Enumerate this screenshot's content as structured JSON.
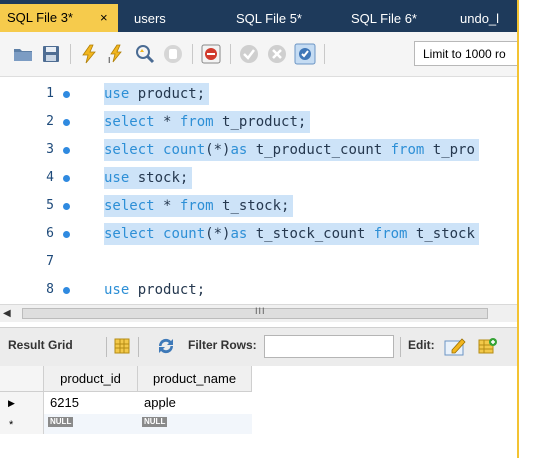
{
  "tabs": [
    {
      "label": "SQL File 3*",
      "active": true,
      "close": "×"
    },
    {
      "label": "users"
    },
    {
      "label": "SQL File 5*"
    },
    {
      "label": "SQL File 6*"
    },
    {
      "label": "undo_l"
    }
  ],
  "toolbar": {
    "limit_label": "Limit to 1000 ro",
    "icons": [
      "open-folder-icon",
      "save-icon",
      "execute-icon",
      "execute-current-icon",
      "explain-icon",
      "stop-icon",
      "toggle-error-icon",
      "commit-icon",
      "rollback-icon",
      "autocommit-icon"
    ]
  },
  "editor": {
    "lines": [
      {
        "num": "1",
        "dot": true,
        "highlight": true,
        "tokens": [
          [
            "kw",
            "use"
          ],
          [
            "id",
            " product;"
          ]
        ]
      },
      {
        "num": "2",
        "dot": true,
        "highlight": true,
        "tokens": [
          [
            "kw",
            "select"
          ],
          [
            "id",
            " * "
          ],
          [
            "kw",
            "from"
          ],
          [
            "id",
            " t_product;"
          ]
        ]
      },
      {
        "num": "3",
        "dot": true,
        "highlight": true,
        "tokens": [
          [
            "kw",
            "select"
          ],
          [
            "id",
            " "
          ],
          [
            "kw",
            "count"
          ],
          [
            "id",
            "(*)"
          ],
          [
            "kw",
            "as"
          ],
          [
            "id",
            " t_product_count "
          ],
          [
            "kw",
            "from"
          ],
          [
            "id",
            " t_pro"
          ]
        ]
      },
      {
        "num": "4",
        "dot": true,
        "highlight": true,
        "tokens": [
          [
            "kw",
            "use"
          ],
          [
            "id",
            " stock;"
          ]
        ]
      },
      {
        "num": "5",
        "dot": true,
        "highlight": true,
        "tokens": [
          [
            "kw",
            "select"
          ],
          [
            "id",
            " * "
          ],
          [
            "kw",
            "from"
          ],
          [
            "id",
            " t_stock;"
          ]
        ]
      },
      {
        "num": "6",
        "dot": true,
        "highlight": true,
        "tokens": [
          [
            "kw",
            "select"
          ],
          [
            "id",
            " "
          ],
          [
            "kw",
            "count"
          ],
          [
            "id",
            "(*)"
          ],
          [
            "kw",
            "as"
          ],
          [
            "id",
            " t_stock_count "
          ],
          [
            "kw",
            "from"
          ],
          [
            "id",
            " t_stock"
          ]
        ]
      },
      {
        "num": "7",
        "dot": false,
        "highlight": false,
        "tokens": []
      },
      {
        "num": "8",
        "dot": true,
        "highlight": false,
        "tokens": [
          [
            "kw",
            "use"
          ],
          [
            "id",
            " product;"
          ]
        ]
      }
    ]
  },
  "scrollbar": {
    "grip": "III",
    "left_arrow": "◀"
  },
  "result_toolbar": {
    "result_grid": "Result Grid",
    "filter_rows": "Filter Rows:",
    "edit": "Edit:"
  },
  "grid": {
    "columns": [
      "product_id",
      "product_name"
    ],
    "rows": [
      {
        "marker": "▶",
        "cells": [
          "6215",
          "apple"
        ]
      },
      {
        "marker": "*",
        "cells": [
          "NULL",
          "NULL"
        ],
        "null_row": true
      }
    ]
  }
}
